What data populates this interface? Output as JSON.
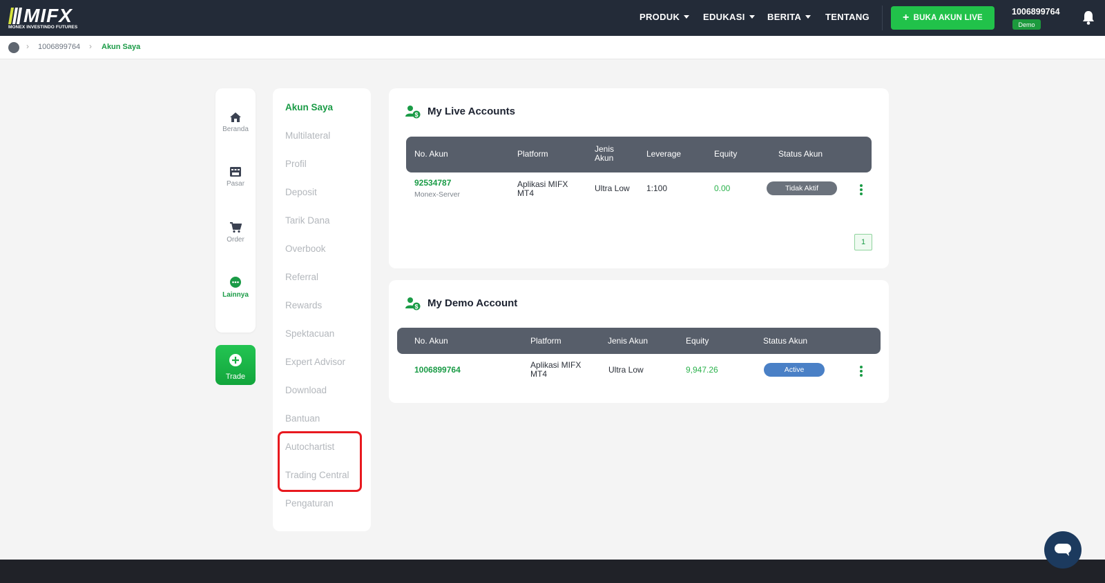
{
  "brand": {
    "logo_text": "MIFX",
    "logo_subtitle": "MONEX INVESTINDO FUTURES",
    "colors": {
      "topbar": "#232b38",
      "accent_green": "#1a9b46",
      "cta_green": "#21c24a"
    }
  },
  "nav": {
    "items": [
      {
        "label": "PRODUK",
        "dropdown": true
      },
      {
        "label": "EDUKASI",
        "dropdown": true
      },
      {
        "label": "BERITA",
        "dropdown": true
      },
      {
        "label": "TENTANG",
        "dropdown": false
      }
    ],
    "cta_label": "BUKA AKUN LIVE",
    "user_id": "1006899764",
    "account_badge": "Demo",
    "icons": {
      "cta": "plus-icon",
      "notifications": "bell-icon"
    }
  },
  "breadcrumb": {
    "items": [
      "1006899764",
      "Akun Saya"
    ]
  },
  "rail": {
    "items": [
      {
        "label": "Beranda",
        "icon": "home-icon"
      },
      {
        "label": "Pasar",
        "icon": "market-icon"
      },
      {
        "label": "Order",
        "icon": "cart-icon"
      },
      {
        "label": "Lainnya",
        "icon": "more-icon",
        "active": true
      }
    ],
    "trade_label": "Trade"
  },
  "menu": {
    "items": [
      "Akun Saya",
      "Multilateral",
      "Profil",
      "Deposit",
      "Tarik Dana",
      "Overbook",
      "Referral",
      "Rewards",
      "Spektacuan",
      "Expert Advisor",
      "Download",
      "Bantuan",
      "Autochartist",
      "Trading Central",
      "Pengaturan"
    ],
    "active": "Akun Saya",
    "highlighted": [
      "Autochartist",
      "Trading Central"
    ]
  },
  "live_accounts": {
    "title": "My Live Accounts",
    "columns": [
      "No. Akun",
      "Platform",
      "Jenis Akun",
      "Leverage",
      "Equity",
      "Status Akun"
    ],
    "rows": [
      {
        "account_no": "92534787",
        "server": "Monex-Server",
        "platform": "Aplikasi MIFX MT4",
        "jenis": "Ultra Low",
        "leverage": "1:100",
        "equity": "0.00",
        "status": "Tidak Aktif"
      }
    ],
    "page": "1"
  },
  "demo_account": {
    "title": "My Demo Account",
    "columns": [
      "No. Akun",
      "Platform",
      "Jenis Akun",
      "Equity",
      "Status Akun"
    ],
    "rows": [
      {
        "account_no": "1006899764",
        "platform": "Aplikasi MIFX MT4",
        "jenis": "Ultra Low",
        "equity": "9,947.26",
        "status": "Active"
      }
    ]
  }
}
